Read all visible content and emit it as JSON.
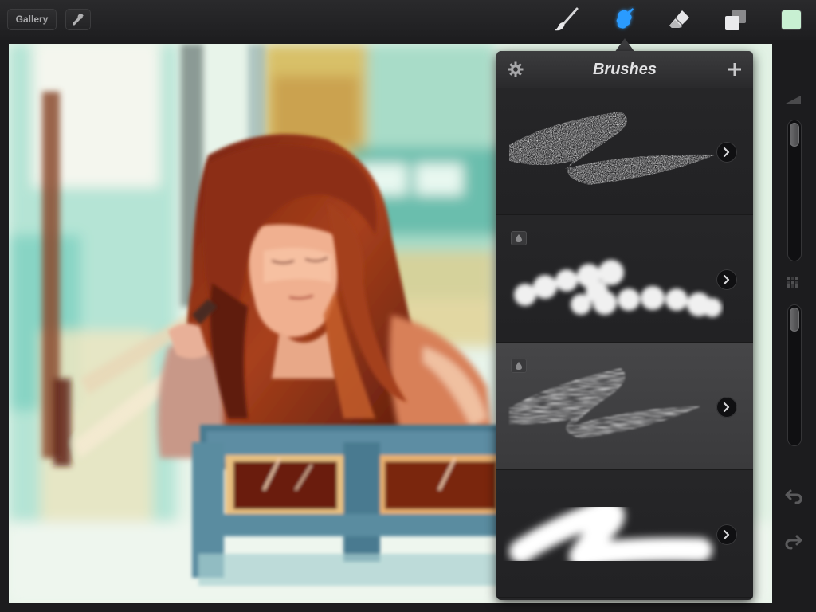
{
  "toolbar": {
    "gallery_label": "Gallery",
    "actions_icon": "wrench-icon",
    "tools": [
      {
        "name": "paint",
        "icon": "brush-icon",
        "active": false
      },
      {
        "name": "smudge",
        "icon": "smudge-icon",
        "active": true
      },
      {
        "name": "erase",
        "icon": "eraser-icon",
        "active": false
      },
      {
        "name": "layers",
        "icon": "layers-icon",
        "active": false
      }
    ],
    "active_tool_color": "#1e90ff",
    "current_color": "#c8f0d2"
  },
  "brushes_panel": {
    "title": "Brushes",
    "settings_icon": "gear-icon",
    "add_icon": "plus-icon",
    "brushes": [
      {
        "has_badge": false,
        "selected": false
      },
      {
        "has_badge": true,
        "selected": false
      },
      {
        "has_badge": true,
        "selected": true
      },
      {
        "has_badge": false,
        "selected": false
      }
    ]
  },
  "sidebar": {
    "size_slider_level": 0.0,
    "opacity_slider_level": 0.0,
    "undo_icon": "undo-icon",
    "redo_icon": "redo-icon"
  }
}
